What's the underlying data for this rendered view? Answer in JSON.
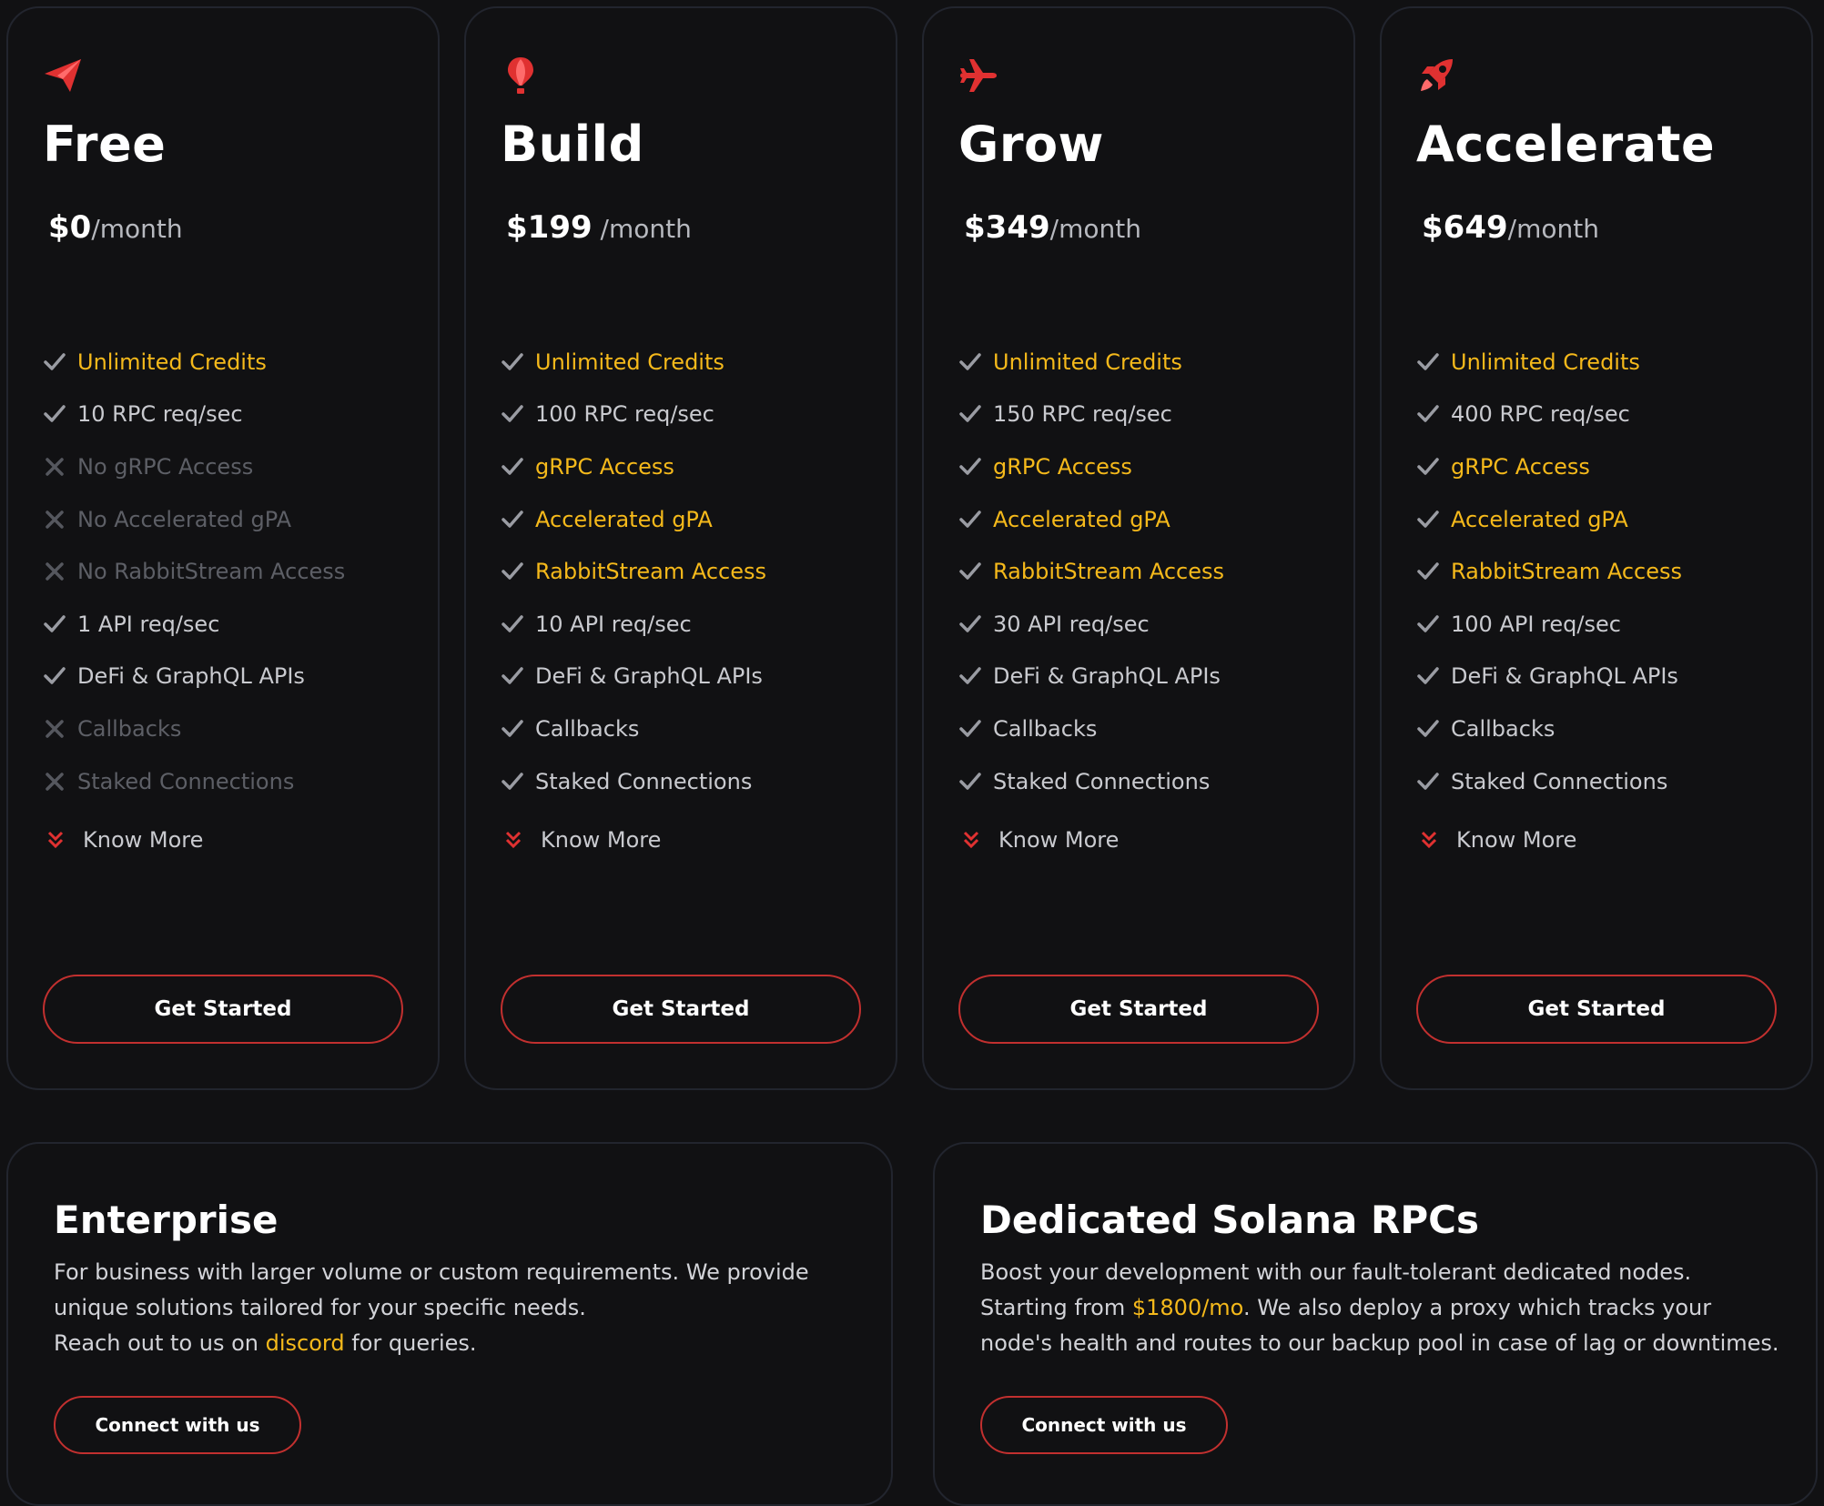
{
  "colors": {
    "background": "#111113",
    "card_border": "#22252e",
    "accent_red": "#e03131",
    "highlight_yellow": "#f5b91b",
    "muted_text": "#5d5f66",
    "feature_text": "#c9cacf"
  },
  "plans": [
    {
      "icon": "paper-plane-icon",
      "name": "Free",
      "price_amount": "$0",
      "price_unit": "/month",
      "features": [
        {
          "label": "Unlimited Credits",
          "status": "included",
          "highlight": true
        },
        {
          "label": "10 RPC req/sec",
          "status": "included",
          "highlight": false
        },
        {
          "label": "No gRPC Access",
          "status": "excluded",
          "highlight": false
        },
        {
          "label": "No Accelerated gPA",
          "status": "excluded",
          "highlight": false
        },
        {
          "label": "No RabbitStream Access",
          "status": "excluded",
          "highlight": false
        },
        {
          "label": "1 API req/sec",
          "status": "included",
          "highlight": false
        },
        {
          "label": "DeFi & GraphQL APIs",
          "status": "included",
          "highlight": false
        },
        {
          "label": "Callbacks",
          "status": "excluded",
          "highlight": false
        },
        {
          "label": "Staked Connections",
          "status": "excluded",
          "highlight": false
        }
      ],
      "know_more_label": "Know More",
      "cta_label": "Get Started"
    },
    {
      "icon": "hot-air-balloon-icon",
      "name": "Build",
      "price_amount": "$199",
      "price_unit": " /month",
      "features": [
        {
          "label": "Unlimited Credits",
          "status": "included",
          "highlight": true
        },
        {
          "label": "100 RPC req/sec",
          "status": "included",
          "highlight": false
        },
        {
          "label": "gRPC Access",
          "status": "included",
          "highlight": true
        },
        {
          "label": "Accelerated gPA",
          "status": "included",
          "highlight": true
        },
        {
          "label": "RabbitStream Access",
          "status": "included",
          "highlight": true
        },
        {
          "label": "10 API req/sec",
          "status": "included",
          "highlight": false
        },
        {
          "label": "DeFi & GraphQL APIs",
          "status": "included",
          "highlight": false
        },
        {
          "label": "Callbacks",
          "status": "included",
          "highlight": false
        },
        {
          "label": "Staked Connections",
          "status": "included",
          "highlight": false
        }
      ],
      "know_more_label": "Know More",
      "cta_label": "Get Started"
    },
    {
      "icon": "airplane-icon",
      "name": "Grow",
      "price_amount": "$349",
      "price_unit": "/month",
      "features": [
        {
          "label": "Unlimited Credits",
          "status": "included",
          "highlight": true
        },
        {
          "label": "150 RPC req/sec",
          "status": "included",
          "highlight": false
        },
        {
          "label": "gRPC Access",
          "status": "included",
          "highlight": true
        },
        {
          "label": "Accelerated gPA",
          "status": "included",
          "highlight": true
        },
        {
          "label": "RabbitStream Access",
          "status": "included",
          "highlight": true
        },
        {
          "label": "30 API req/sec",
          "status": "included",
          "highlight": false
        },
        {
          "label": "DeFi & GraphQL APIs",
          "status": "included",
          "highlight": false
        },
        {
          "label": "Callbacks",
          "status": "included",
          "highlight": false
        },
        {
          "label": "Staked Connections",
          "status": "included",
          "highlight": false
        }
      ],
      "know_more_label": "Know More",
      "cta_label": "Get Started"
    },
    {
      "icon": "rocket-icon",
      "name": "Accelerate",
      "price_amount": "$649",
      "price_unit": "/month",
      "features": [
        {
          "label": "Unlimited Credits",
          "status": "included",
          "highlight": true
        },
        {
          "label": "400 RPC req/sec",
          "status": "included",
          "highlight": false
        },
        {
          "label": "gRPC Access",
          "status": "included",
          "highlight": true
        },
        {
          "label": "Accelerated gPA",
          "status": "included",
          "highlight": true
        },
        {
          "label": "RabbitStream Access",
          "status": "included",
          "highlight": true
        },
        {
          "label": "100 API req/sec",
          "status": "included",
          "highlight": false
        },
        {
          "label": "DeFi & GraphQL APIs",
          "status": "included",
          "highlight": false
        },
        {
          "label": "Callbacks",
          "status": "included",
          "highlight": false
        },
        {
          "label": "Staked Connections",
          "status": "included",
          "highlight": false
        }
      ],
      "know_more_label": "Know More",
      "cta_label": "Get Started"
    }
  ],
  "enterprise": {
    "title": "Enterprise",
    "text_1": "For business with larger volume or custom requirements. We provide unique solutions tailored for your specific needs.",
    "text_2_prefix": "Reach out to us on ",
    "link_label": "discord",
    "text_2_suffix": " for queries.",
    "cta_label": "Connect with us"
  },
  "dedicated": {
    "title": "Dedicated Solana RPCs",
    "text_prefix": "Boost your development with our fault-tolerant dedicated nodes. Starting from ",
    "price_highlight": "$1800/mo",
    "text_suffix": ". We also deploy a proxy which tracks your node's health and routes to our backup pool in case of lag or downtimes.",
    "cta_label": "Connect with us"
  }
}
